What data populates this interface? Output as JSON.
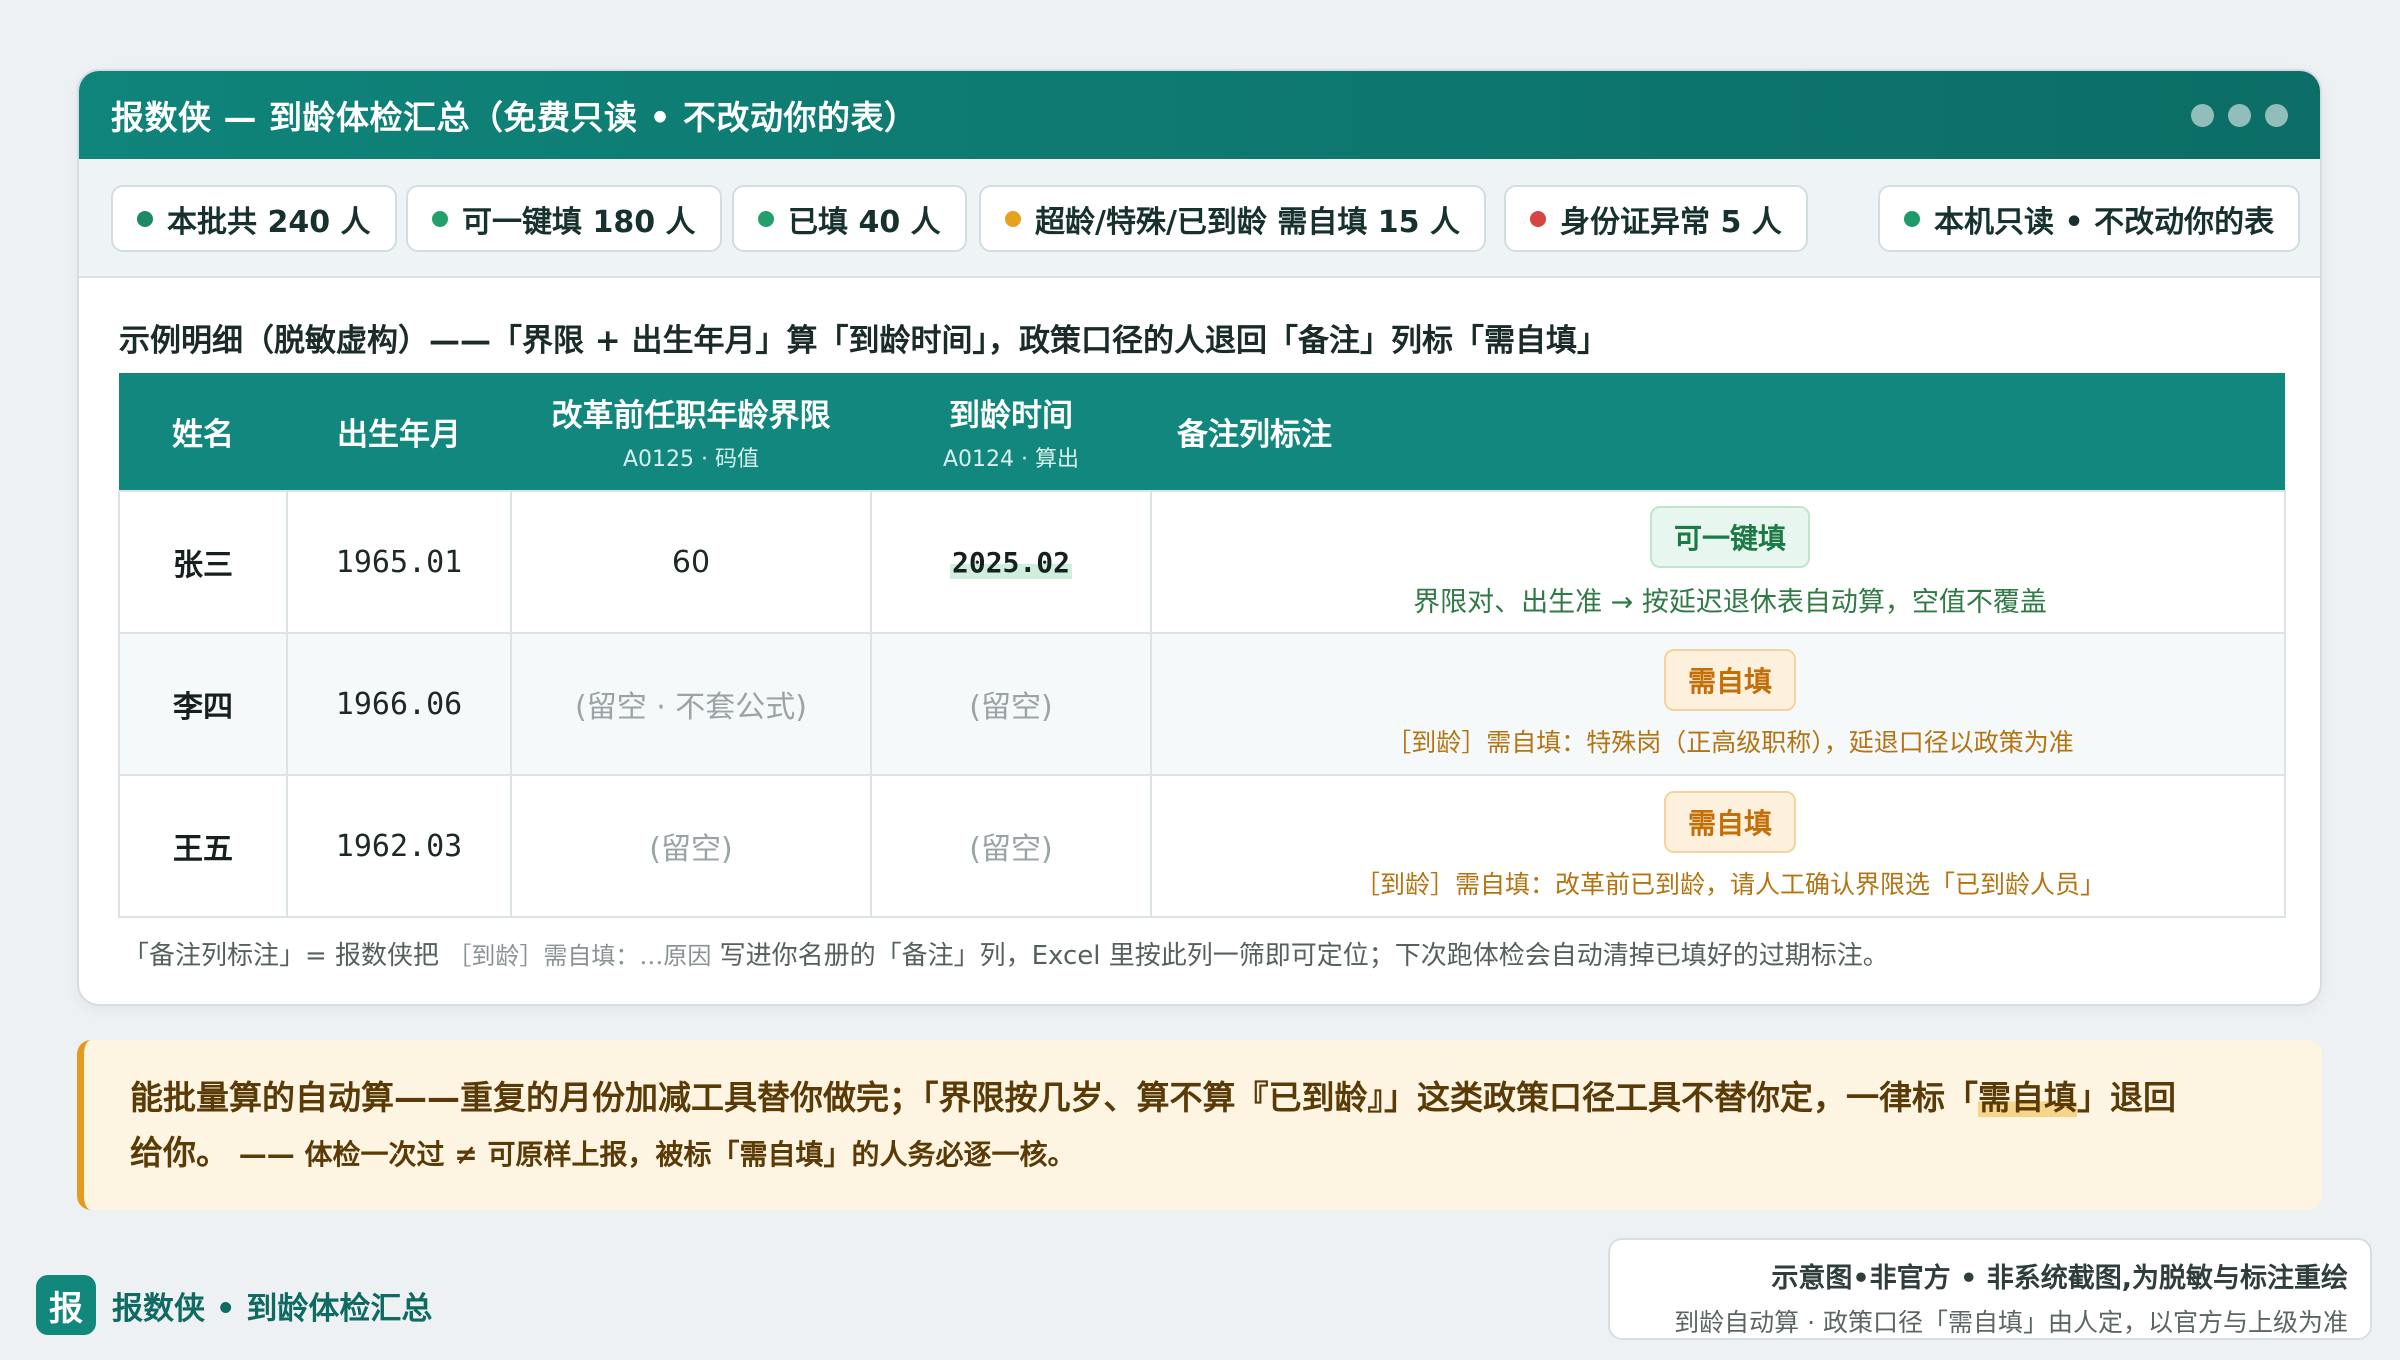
{
  "window": {
    "title": "报数侠 — 到龄体检汇总（免费只读 • 不改动你的表）"
  },
  "stats": [
    {
      "label": "本批共 240 人",
      "color": "#1c8a66"
    },
    {
      "label": "可一键填 180 人",
      "color": "#22a06b"
    },
    {
      "label": "已填 40 人",
      "color": "#22a06b"
    },
    {
      "label": "超龄/特殊/已到龄 需自填 15 人",
      "color": "#e5a21f"
    },
    {
      "label": "身份证异常 5 人",
      "color": "#d64541"
    },
    {
      "label": "本机只读 • 不改动你的表",
      "color": "#1c9a6a"
    }
  ],
  "section": {
    "title": "示例明细（脱敏虚构）——「界限 + 出生年月」算「到龄时间」，政策口径的人退回「备注」列标「需自填」"
  },
  "table": {
    "headers": {
      "name": "姓名",
      "birth": "出生年月",
      "limit": "改革前任职年龄界限",
      "limit_sub": "A0125 · 码值",
      "due": "到龄时间",
      "due_sub": "A0124 · 算出",
      "note": "备注列标注"
    },
    "rows": [
      {
        "name": "张三",
        "birth": "1965.01",
        "limit": "60",
        "due": "2025.02",
        "tag": "可一键填",
        "note": "界限对、出生准 → 按延迟退休表自动算，空值不覆盖"
      },
      {
        "name": "李四",
        "birth": "1966.06",
        "limit": "(留空 · 不套公式)",
        "due": "(留空)",
        "tag": "需自填",
        "note": "［到龄］需自填：特殊岗（正高级职称），延退口径以政策为准"
      },
      {
        "name": "王五",
        "birth": "1962.03",
        "limit": "(留空)",
        "due": "(留空)",
        "tag": "需自填",
        "note": "［到龄］需自填：改革前已到龄，请人工确认界限选「已到龄人员」"
      }
    ]
  },
  "footnote": {
    "prefix": "「备注列标注」= 报数侠把",
    "mark": "［到龄］需自填：…原因",
    "suffix": "写进你名册的「备注」列，Excel 里按此列一筛即可定位；下次跑体检会自动清掉已填好的过期标注。"
  },
  "callout": {
    "line1_a": "能批量算的自动算——重复的月份加减工具替你做完；「界限按几岁、算不算『已到龄』」这类政策口径工具不替你定，一律标「",
    "line1_hl": "需自填",
    "line1_b": "」退回",
    "line2_lead": "给你。",
    "line2_rest": "—— 体检一次过 ≠ 可原样上报，被标「需自填」的人务必逐一核。"
  },
  "brand": {
    "logo": "报",
    "name": "报数侠 • 到龄体检汇总"
  },
  "disclaimer": {
    "line1": "示意图•非官方 • 非系统截图,为脱敏与标注重绘",
    "line2": "到龄自动算 · 政策口径「需自填」由人定，以官方与上级为准"
  }
}
